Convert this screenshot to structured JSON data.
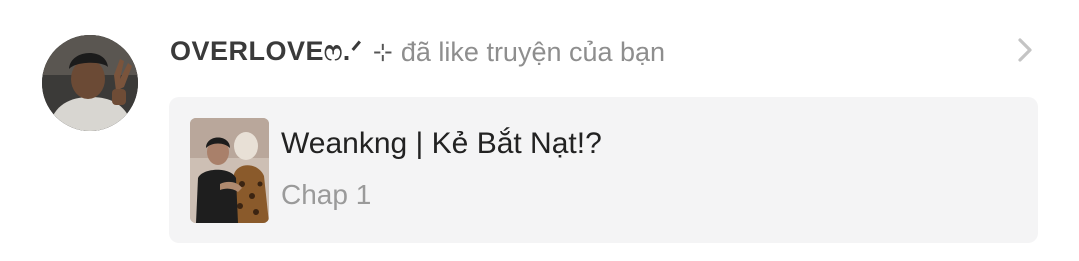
{
  "notification": {
    "username": "OVERLOVEෆ.ᐟ",
    "separator": "⊹",
    "action": "đã like truyện của bạn",
    "chevron_icon": "chevron-right-icon",
    "story": {
      "title": "Weankng | Kẻ Bắt Nạt!?",
      "chapter": "Chap 1"
    }
  },
  "colors": {
    "username": "#3a3a3a",
    "action_text": "#8e8e8e",
    "card_background": "#f4f4f5",
    "title_text": "#222222",
    "chapter_text": "#9a9a9a",
    "chevron": "#c4c4c4"
  }
}
